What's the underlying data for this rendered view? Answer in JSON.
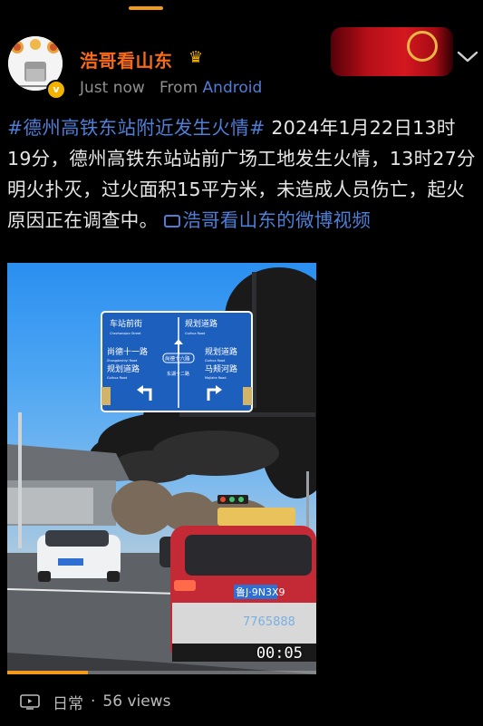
{
  "header": {
    "tab_indicator_color": "#f39a1c"
  },
  "post": {
    "author": "浩哥看山东",
    "author_badge": "crown-icon",
    "verified_badge": "v",
    "time": "Just now",
    "source_prefix": "From",
    "source": "Android",
    "hashtag": "#德州高铁东站附近发生火情#",
    "body": " 2024年1月22日13时19分，德州高铁东站站前广场工地发生火情，13时27分明火扑灭，过火面积15平方米，未造成人员伤亡，起火原因正在调查中。",
    "video_link": "浩哥看山东的微博视频"
  },
  "video": {
    "time": "00:05",
    "progress": 0.26,
    "sign": {
      "top_left": "车站前街",
      "top_left_en": "Chezhanqian Street",
      "top_right": "规划道路",
      "top_right_en": "Guihua Road",
      "left_1": "尚德十一路",
      "left_1_en": "Shangdeshiyi Road",
      "left_2": "规划道路",
      "left_2_en": "Guihua Road",
      "right_1": "规划道路",
      "right_1_en": "Guihua Road",
      "right_2": "马颊河路",
      "right_2_en": "Majiahe Road",
      "center_top": "尚德十六路",
      "center_bottom": "东湖十二路"
    },
    "plate": "鲁J·9N3X9",
    "taxi_phone": "7765888"
  },
  "footer": {
    "icon": "tv-icon",
    "label": "日常",
    "separator": "·",
    "views": "56 views"
  }
}
